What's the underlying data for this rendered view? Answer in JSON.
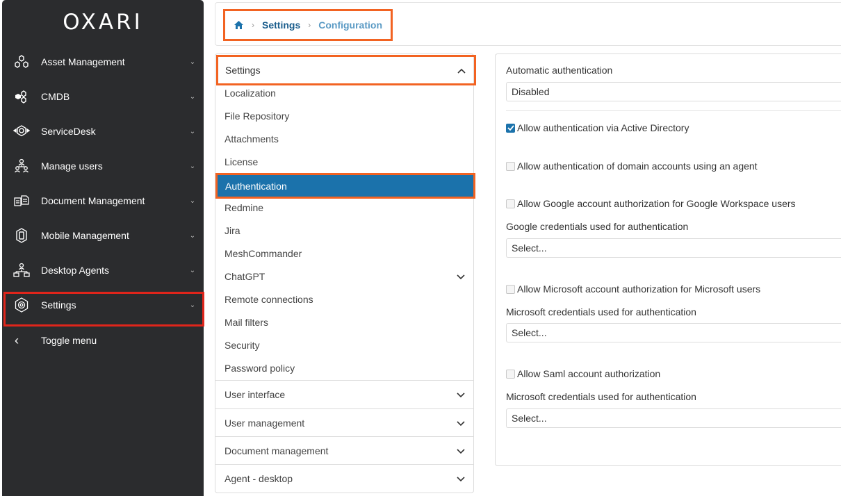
{
  "sidebar": {
    "logo": "OXARI",
    "items": [
      {
        "label": "Asset Management",
        "chevron": "⌄",
        "icon": "asset-icon"
      },
      {
        "label": "CMDB",
        "chevron": "⌄",
        "icon": "cmdb-icon"
      },
      {
        "label": "ServiceDesk",
        "chevron": "⌄",
        "icon": "servicedesk-icon"
      },
      {
        "label": "Manage users",
        "chevron": "⌄",
        "icon": "users-icon"
      },
      {
        "label": "Document Management",
        "chevron": "⌄",
        "icon": "document-icon"
      },
      {
        "label": "Mobile Management",
        "chevron": "⌄",
        "icon": "mobile-icon"
      },
      {
        "label": "Desktop Agents",
        "chevron": "⌄",
        "icon": "desktop-agents-icon"
      },
      {
        "label": "Settings",
        "chevron": "⌄",
        "icon": "settings-icon"
      }
    ],
    "toggle": {
      "chevron": "‹",
      "label": "Toggle menu"
    }
  },
  "breadcrumb": {
    "home_icon": "home-icon",
    "sep1": "›",
    "settings": "Settings",
    "sep2": "›",
    "current": "Configuration"
  },
  "settings_menu": {
    "header": "Settings",
    "items": [
      "Localization",
      "File Repository",
      "Attachments",
      "License",
      "Authentication",
      "Redmine",
      "Jira",
      "MeshCommander",
      "ChatGPT",
      "Remote connections",
      "Mail filters",
      "Security",
      "Password policy"
    ],
    "active": "Authentication",
    "sections": [
      "User interface",
      "User management",
      "Document management",
      "Agent - desktop"
    ]
  },
  "form": {
    "auto_auth_label": "Automatic authentication",
    "auto_auth_value": "Disabled",
    "ad_label": "Allow authentication via Active Directory",
    "ad_checked": true,
    "agent_label": "Allow authentication of domain accounts using an agent",
    "google_label": "Allow Google account authorization for Google Workspace users",
    "google_cred_label": "Google credentials used for authentication",
    "google_cred_placeholder": "Select...",
    "ms_label": "Allow Microsoft account authorization for Microsoft users",
    "ms_cred_label": "Microsoft credentials used for authentication",
    "ms_cred_placeholder": "Select...",
    "saml_label": "Allow Saml account authorization",
    "saml_cred_label": "Microsoft credentials used for authentication",
    "saml_cred_placeholder": "Select..."
  },
  "colors": {
    "sidebar_bg": "#2b2c2e",
    "accent_blue": "#1b72ab",
    "highlight_orange": "#f26322",
    "highlight_red": "#e0251b"
  }
}
